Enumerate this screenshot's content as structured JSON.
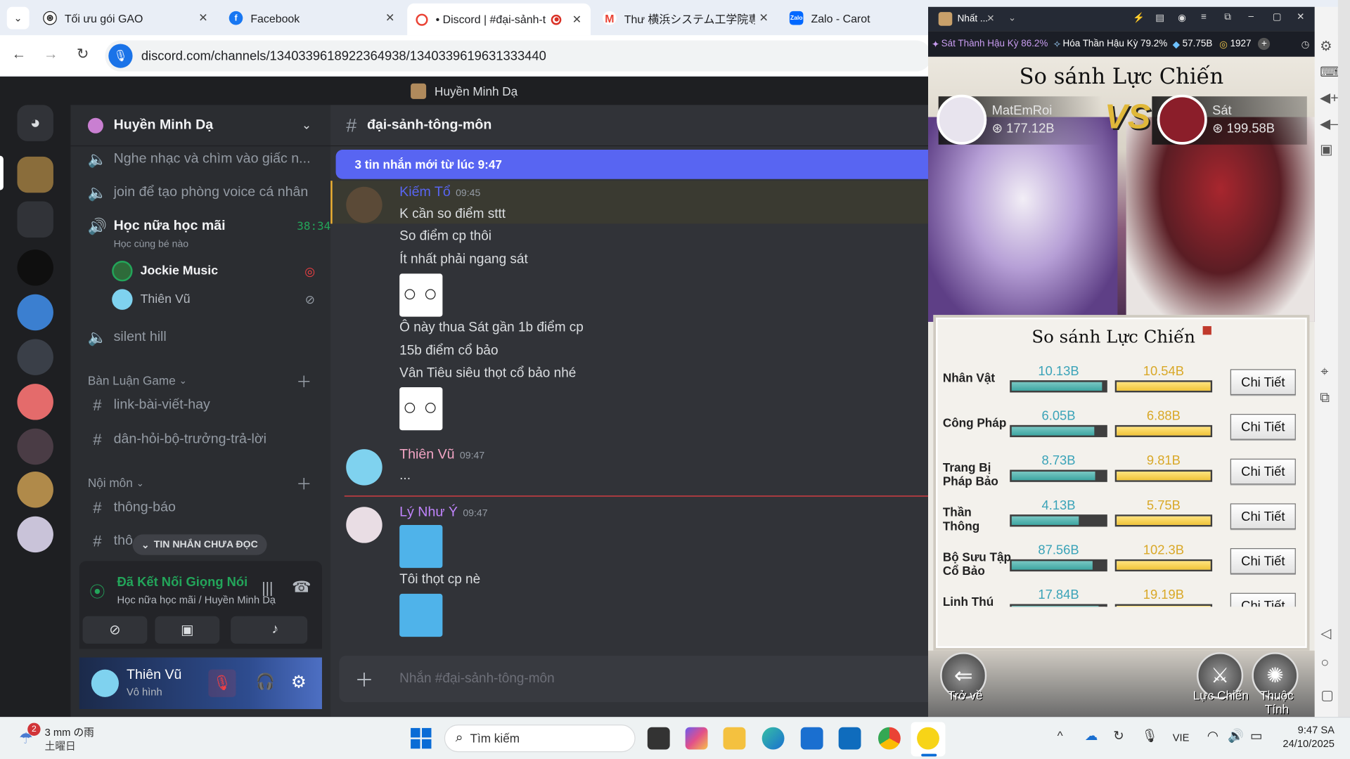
{
  "browser": {
    "tabs": [
      {
        "title": "Tối ưu gói GAO",
        "icon": "chatgpt-icon"
      },
      {
        "title": "Facebook",
        "icon": "facebook-icon"
      },
      {
        "title": "• Discord | #đại-sảnh-t",
        "icon": "discord-icon",
        "active": true
      },
      {
        "title": "Thư 横浜システム工学院専門",
        "icon": "gmail-icon"
      },
      {
        "title": "Zalo - Carot",
        "icon": "zalo-icon"
      }
    ],
    "url": "discord.com/channels/1340339618922364938/1340339619631333440"
  },
  "discord": {
    "title": "Huyền Minh Dạ",
    "server_name": "Huyền Minh Dạ",
    "channels_top": [
      {
        "name": "Nghe nhạc và chìm vào giấc n..."
      },
      {
        "name": "join để tạo phòng voice cá nhân"
      }
    ],
    "active_voice": {
      "name": "Học nữa học mãi",
      "timer": "38:34",
      "status": "Học cùng bé nào"
    },
    "voice_members": [
      {
        "name": "Jockie Music"
      },
      {
        "name": "Thiên Vũ"
      }
    ],
    "channel_silent": "silent hill",
    "categories": [
      {
        "label": "Bàn Luận Game",
        "channels": [
          "link-bài-viết-hay",
          "dân-hỏi-bộ-trưởng-trả-lời"
        ]
      },
      {
        "label": "Nội môn",
        "channels": [
          "thông-báo",
          "thô"
        ]
      }
    ],
    "unread_pill": "TIN NHẮN CHƯA ĐỌC",
    "voice_status": {
      "title": "Đã Kết Nối Giọng Nói",
      "sub": "Học nữa học mãi / Huyền Minh Dạ"
    },
    "user": {
      "name": "Thiên Vũ",
      "status": "Vô hình"
    },
    "chat_channel": "đại-sảnh-tông-môn",
    "new_messages_bar": "3 tin nhắn mới từ lúc 9:47",
    "messages": [
      {
        "author": "Kiếm Tổ",
        "time": "09:45",
        "lines": [
          "K cần so điểm sttt",
          "So điểm cp thôi",
          "Ít nhất phải ngang sát",
          "Ô này thua Sát gần 1b điểm cp",
          "15b điểm cổ bảo",
          "Vân Tiêu siêu thọt cổ bảo nhé"
        ]
      },
      {
        "author": "Thiên Vũ",
        "time": "09:47",
        "lines": [
          "..."
        ]
      },
      {
        "author": "Lý Như Ý",
        "time": "09:47",
        "lines": [
          "Tôi thọt cp nè"
        ]
      }
    ],
    "composer_placeholder": "Nhắn #đại-sảnh-tông-môn"
  },
  "game": {
    "window_title": "Nhất ...",
    "stats": [
      "Sát Thành Hậu Kỳ 86.2%",
      "Hóa Thần Hậu Kỳ 79.2%",
      "57.75B",
      "1927"
    ],
    "header": "So sánh Lực Chiến",
    "vs": "VS",
    "player_left": {
      "name": "MatEmRoi",
      "power": "177.12B"
    },
    "player_right": {
      "name": "Sát",
      "power": "199.58B"
    },
    "table_title": "So sánh Lực Chiến",
    "detail_label": "Chi Tiết",
    "rows": [
      {
        "label": "Nhân Vật",
        "left": "10.13B",
        "right": "10.54B",
        "left_fill": 0.96
      },
      {
        "label": "Công Pháp",
        "left": "6.05B",
        "right": "6.88B",
        "left_fill": 0.88
      },
      {
        "label": "Trang Bị Pháp Bảo",
        "left": "8.73B",
        "right": "9.81B",
        "left_fill": 0.89
      },
      {
        "label": "Thần Thông",
        "left": "4.13B",
        "right": "5.75B",
        "left_fill": 0.72
      },
      {
        "label": "Bộ Sưu Tập Cổ Bảo",
        "left": "87.56B",
        "right": "102.3B",
        "left_fill": 0.86
      },
      {
        "label": "Linh Thú",
        "left": "17.84B",
        "right": "19.19B",
        "left_fill": 0.93
      }
    ],
    "bottom_buttons": [
      "Trở về",
      "Lực Chiến",
      "Thuộc Tính"
    ]
  },
  "taskbar": {
    "weather": "3 mm の雨",
    "weather_day": "土曜日",
    "weather_badge": "2",
    "search_placeholder": "Tìm kiếm",
    "lang": "VIE",
    "time": "9:47 SA",
    "date": "24/10/2025"
  }
}
